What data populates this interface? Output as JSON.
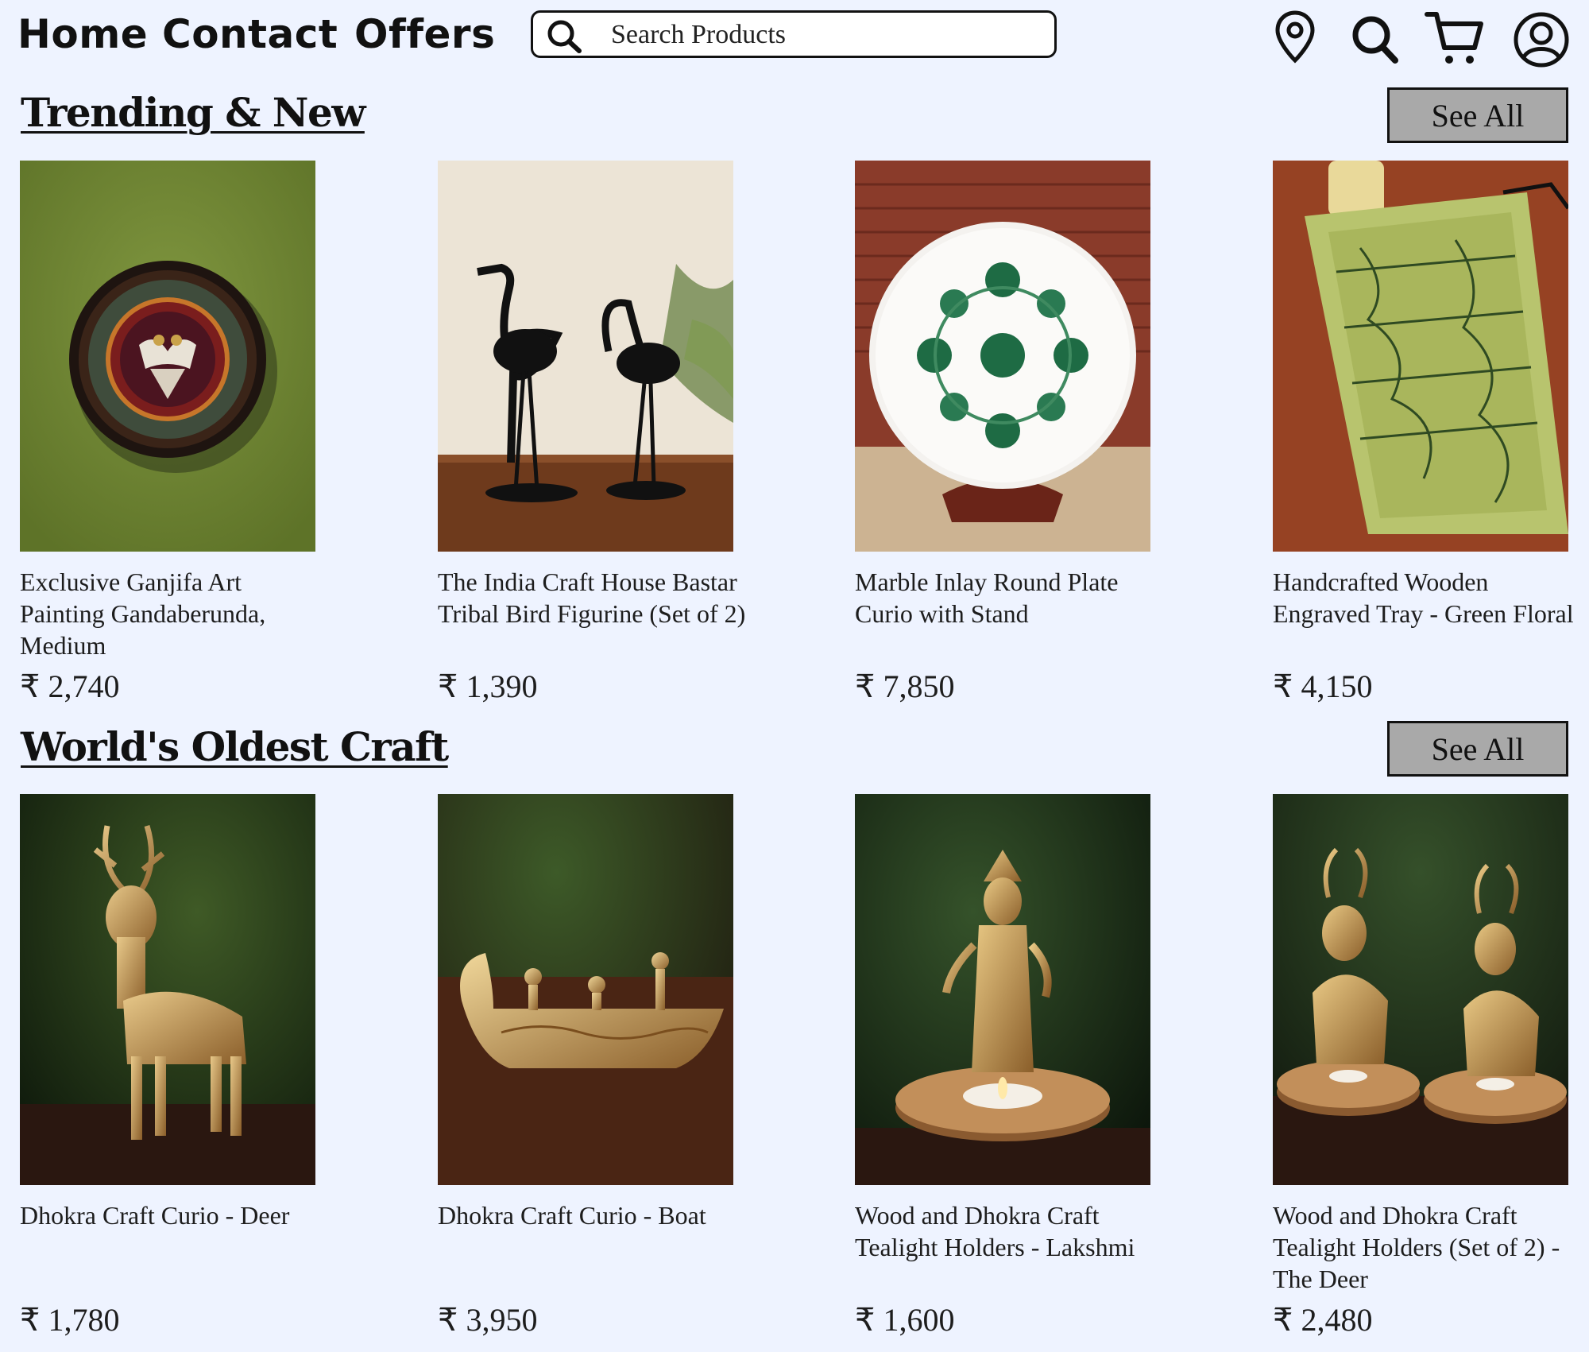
{
  "nav": {
    "home": "Home",
    "contact": "Contact",
    "offers": "Offers"
  },
  "search": {
    "placeholder": "Search Products"
  },
  "icons": [
    "location-pin-icon",
    "search-icon",
    "cart-icon",
    "user-account-icon"
  ],
  "sections": [
    {
      "title": "Trending & New",
      "see_all": "See All",
      "products": [
        {
          "name": "Exclusive Ganjifa Art Painting Gandaberunda, Medium",
          "price": "₹ 2,740"
        },
        {
          "name": "The India Craft House Bastar Tribal Bird Figurine (Set of 2)",
          "price": "₹ 1,390"
        },
        {
          "name": "Marble Inlay Round Plate Curio with Stand",
          "price": "₹ 7,850"
        },
        {
          "name": "Handcrafted Wooden Engraved Tray - Green Floral",
          "price": "₹ 4,150"
        }
      ]
    },
    {
      "title": "World's Oldest Craft",
      "see_all": "See All",
      "products": [
        {
          "name": "Dhokra Craft Curio - Deer",
          "price": "₹ 1,780"
        },
        {
          "name": "Dhokra Craft Curio - Boat",
          "price": "₹ 3,950"
        },
        {
          "name": "Wood and Dhokra Craft Tealight Holders - Lakshmi",
          "price": "₹ 1,600"
        },
        {
          "name": "Wood and Dhokra Craft Tealight Holders (Set of 2) - The Deer",
          "price": "₹ 2,480"
        }
      ]
    }
  ]
}
